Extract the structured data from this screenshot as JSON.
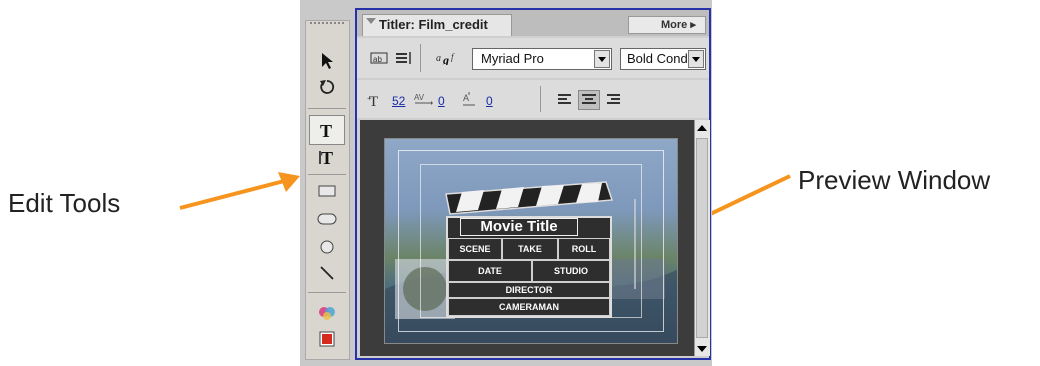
{
  "callouts": {
    "edit_tools": "Edit Tools",
    "preview_window": "Preview Window",
    "arrow_color": "#f7941d"
  },
  "panel": {
    "title": "Titler: Film_credit",
    "more_label": "More ▸",
    "border_color": "#2731a8"
  },
  "toolbar": {
    "font_family": "Myriad Pro",
    "font_style": "Bold Cond",
    "font_size": "52",
    "kerning": "0",
    "leading": "0"
  },
  "toolbox": {
    "tools": [
      "selection-tool",
      "rotation-tool",
      "type-tool",
      "vertical-type-tool",
      "rectangle-tool",
      "rounded-rectangle-tool",
      "ellipse-tool",
      "line-tool",
      "styles-tool",
      "fill-color-tool"
    ]
  },
  "preview": {
    "clapboard": {
      "title": "Movie Title",
      "scene": "SCENE",
      "take": "TAKE",
      "roll": "ROLL",
      "date": "DATE",
      "studio": "STUDIO",
      "director": "DIRECTOR",
      "cameraman": "CAMERAMAN"
    }
  }
}
